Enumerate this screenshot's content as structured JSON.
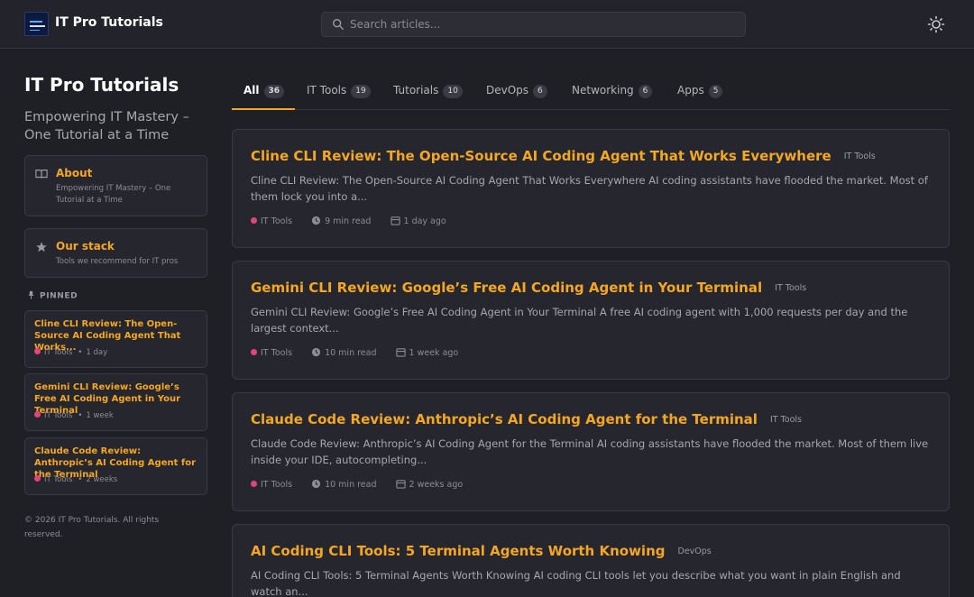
{
  "header": {
    "brand": "IT Pro Tutorials",
    "search_placeholder": "Search articles...",
    "theme_icon": "sun-icon"
  },
  "sidebar": {
    "title": "IT Pro Tutorials",
    "tagline": "Empowering IT Mastery – One Tutorial at a Time",
    "about": {
      "title": "About",
      "desc": "Empowering IT Mastery – One Tutorial at a Time",
      "icon": "book-icon"
    },
    "stack": {
      "title": "Our stack",
      "desc": "Tools we recommend for IT pros",
      "icon": "star-icon"
    },
    "pinned_label": "PINNED",
    "pinned": [
      {
        "title": "Cline CLI Review: The Open-Source AI Coding Agent That Works...",
        "category": "IT Tools",
        "time": "1 day"
      },
      {
        "title": "Gemini CLI Review: Google’s Free AI Coding Agent in Your Terminal",
        "category": "IT Tools",
        "time": "1 week"
      },
      {
        "title": "Claude Code Review: Anthropic’s AI Coding Agent for the Terminal",
        "category": "IT Tools",
        "time": "2 weeks"
      }
    ],
    "footer": "© 2026 IT Pro Tutorials. All rights reserved."
  },
  "tabs": [
    {
      "label": "All",
      "count": "36",
      "active": true
    },
    {
      "label": "IT Tools",
      "count": "19"
    },
    {
      "label": "Tutorials",
      "count": "10"
    },
    {
      "label": "DevOps",
      "count": "6"
    },
    {
      "label": "Networking",
      "count": "6"
    },
    {
      "label": "Apps",
      "count": "5"
    }
  ],
  "articles": [
    {
      "title": "Cline CLI Review: The Open-Source AI Coding Agent That Works Everywhere",
      "category": "IT Tools",
      "excerpt": "Cline CLI Review: The Open-Source AI Coding Agent That Works Everywhere AI coding assistants have flooded the market. Most of them lock you into a...",
      "tag": "IT Tools",
      "read_time": "9 min read",
      "date": "1 day ago"
    },
    {
      "title": "Gemini CLI Review: Google’s Free AI Coding Agent in Your Terminal",
      "category": "IT Tools",
      "excerpt": "Gemini CLI Review: Google’s Free AI Coding Agent in Your Terminal A free AI coding agent with 1,000 requests per day and the largest context...",
      "tag": "IT Tools",
      "read_time": "10 min read",
      "date": "1 week ago"
    },
    {
      "title": "Claude Code Review: Anthropic’s AI Coding Agent for the Terminal",
      "category": "IT Tools",
      "excerpt": "Claude Code Review: Anthropic’s AI Coding Agent for the Terminal AI coding assistants have flooded the market. Most of them live inside your IDE, autocompleting...",
      "tag": "IT Tools",
      "read_time": "10 min read",
      "date": "2 weeks ago"
    },
    {
      "title": "AI Coding CLI Tools: 5 Terminal Agents Worth Knowing",
      "category": "DevOps",
      "excerpt": "AI Coding CLI Tools: 5 Terminal Agents Worth Knowing AI coding CLI tools let you describe what you want in plain English and watch an...",
      "tag": "DevOps",
      "read_time": "",
      "date": ""
    }
  ],
  "colors": {
    "accent": "#f5a623",
    "tag_dot": "#e0467c",
    "background": "#1f2026",
    "card": "#26272e"
  }
}
